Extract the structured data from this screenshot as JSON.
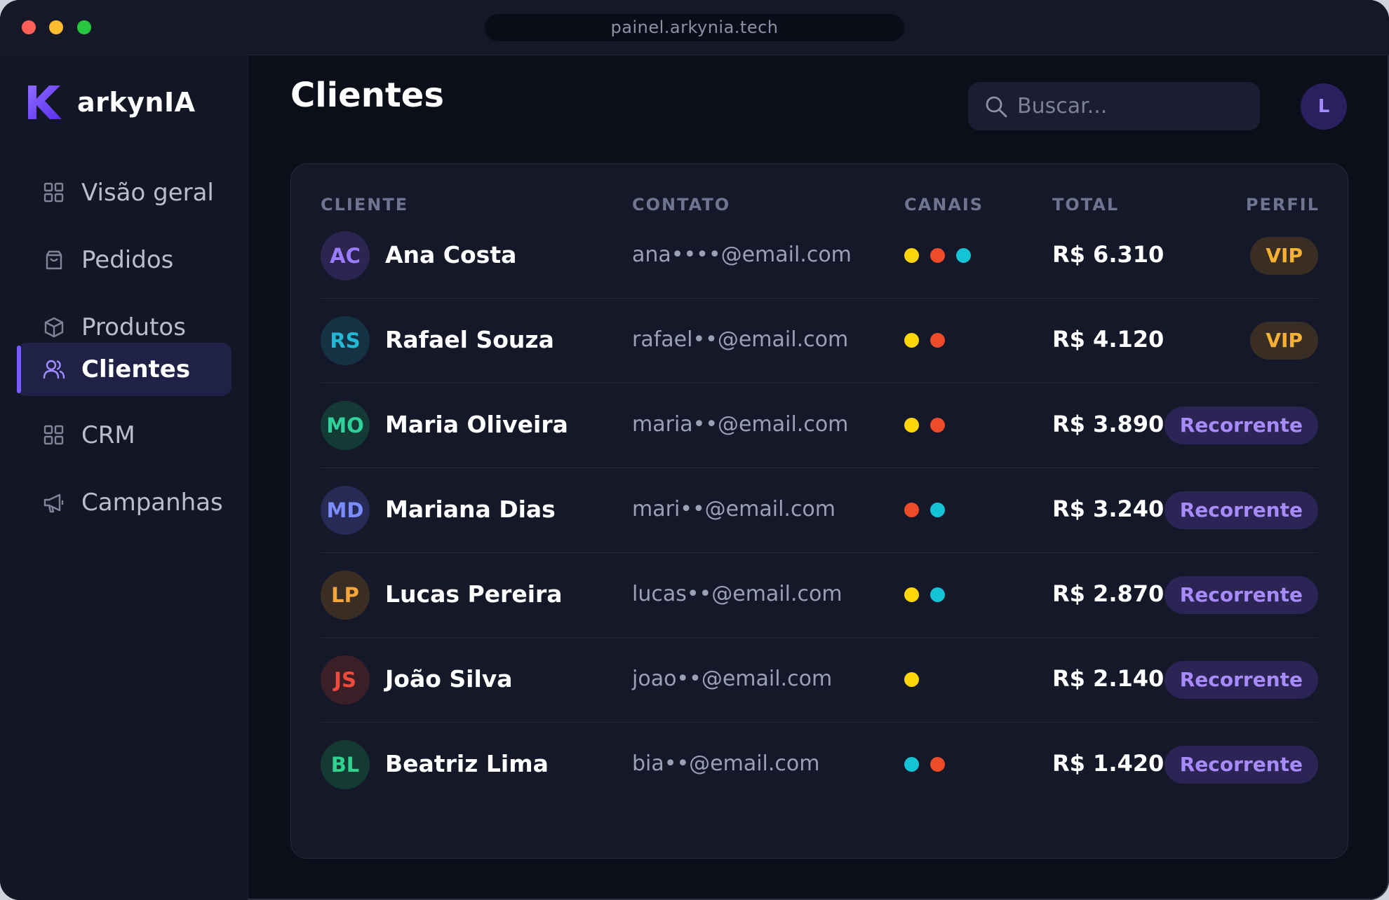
{
  "browser": {
    "url": "painel.arkynia.tech"
  },
  "brand": {
    "name": "arkynIA",
    "accent": "#7c5cff"
  },
  "sidebar": {
    "items": [
      {
        "label": "Visão geral",
        "icon": "grid-icon",
        "active": false
      },
      {
        "label": "Pedidos",
        "icon": "shopping-bag-icon",
        "active": false
      },
      {
        "label": "Produtos",
        "icon": "box-icon",
        "active": false
      },
      {
        "label": "Clientes",
        "icon": "users-icon",
        "active": true
      },
      {
        "label": "CRM",
        "icon": "grid-icon",
        "active": false
      },
      {
        "label": "Campanhas",
        "icon": "megaphone-icon",
        "active": false
      }
    ]
  },
  "header": {
    "title": "Clientes",
    "search_placeholder": "Buscar...",
    "user_initial": "L"
  },
  "table": {
    "columns": [
      "CLIENTE",
      "CONTATO",
      "CANAIS",
      "TOTAL",
      "PERFIL"
    ],
    "channel_colors": {
      "yellow": "#ffd60a",
      "red": "#ee4b2b",
      "cyan": "#14c4d6"
    },
    "rows": [
      {
        "initials": "AC",
        "name": "Ana Costa",
        "email": "ana••••@email.com",
        "channels": [
          "yellow",
          "red",
          "cyan"
        ],
        "total": "R$ 6.310",
        "profile": "VIP",
        "avatar_bg": "#2b2550",
        "avatar_fg": "#9b7cff"
      },
      {
        "initials": "RS",
        "name": "Rafael Souza",
        "email": "rafael••@email.com",
        "channels": [
          "yellow",
          "red"
        ],
        "total": "R$ 4.120",
        "profile": "VIP",
        "avatar_bg": "#143244",
        "avatar_fg": "#22b8d6"
      },
      {
        "initials": "MO",
        "name": "Maria Oliveira",
        "email": "maria••@email.com",
        "channels": [
          "yellow",
          "red"
        ],
        "total": "R$ 3.890",
        "profile": "Recorrente",
        "avatar_bg": "#143a35",
        "avatar_fg": "#2fd39a"
      },
      {
        "initials": "MD",
        "name": "Mariana Dias",
        "email": "mari••@email.com",
        "channels": [
          "red",
          "cyan"
        ],
        "total": "R$ 3.240",
        "profile": "Recorrente",
        "avatar_bg": "#252b55",
        "avatar_fg": "#7b8cff"
      },
      {
        "initials": "LP",
        "name": "Lucas Pereira",
        "email": "lucas••@email.com",
        "channels": [
          "yellow",
          "cyan"
        ],
        "total": "R$ 2.870",
        "profile": "Recorrente",
        "avatar_bg": "#3a2e24",
        "avatar_fg": "#f5a53a"
      },
      {
        "initials": "JS",
        "name": "João Silva",
        "email": "joao••@email.com",
        "channels": [
          "yellow"
        ],
        "total": "R$ 2.140",
        "profile": "Recorrente",
        "avatar_bg": "#3a1f26",
        "avatar_fg": "#ee4b3b"
      },
      {
        "initials": "BL",
        "name": "Beatriz Lima",
        "email": "bia••@email.com",
        "channels": [
          "cyan",
          "red"
        ],
        "total": "R$ 1.420",
        "profile": "Recorrente",
        "avatar_bg": "#143a33",
        "avatar_fg": "#2fd38f"
      }
    ]
  }
}
